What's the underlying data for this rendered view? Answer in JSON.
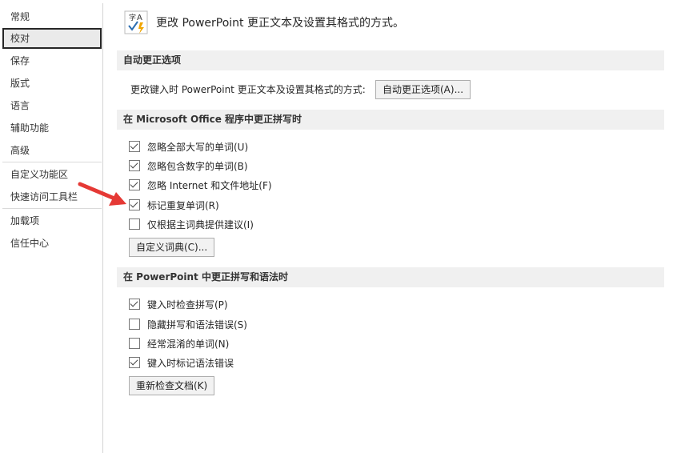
{
  "sidebar": {
    "items": [
      {
        "label": "常规",
        "selected": false
      },
      {
        "label": "校对",
        "selected": true
      },
      {
        "label": "保存",
        "selected": false
      },
      {
        "label": "版式",
        "selected": false
      },
      {
        "label": "语言",
        "selected": false
      },
      {
        "label": "辅助功能",
        "selected": false
      },
      {
        "label": "高级",
        "selected": false
      },
      {
        "label": "自定义功能区",
        "selected": false
      },
      {
        "label": "快速访问工具栏",
        "selected": false
      },
      {
        "label": "加载项",
        "selected": false
      },
      {
        "label": "信任中心",
        "selected": false
      }
    ]
  },
  "header": {
    "title": "更改 PowerPoint 更正文本及设置其格式的方式。",
    "icon": "abc-autocorrect-icon"
  },
  "autocorrect": {
    "section_title": "自动更正选项",
    "description": "更改键入时 PowerPoint 更正文本及设置其格式的方式:",
    "button_label": "自动更正选项(A)..."
  },
  "office_spelling": {
    "section_title": "在 Microsoft Office 程序中更正拼写时",
    "options": [
      {
        "label": "忽略全部大写的单词(U)",
        "checked": true
      },
      {
        "label": "忽略包含数字的单词(B)",
        "checked": true
      },
      {
        "label": "忽略 Internet 和文件地址(F)",
        "checked": true
      },
      {
        "label": "标记重复单词(R)",
        "checked": true
      },
      {
        "label": "仅根据主词典提供建议(I)",
        "checked": false
      }
    ],
    "custom_dict_button": "自定义词典(C)..."
  },
  "ppt_spelling": {
    "section_title": "在 PowerPoint 中更正拼写和语法时",
    "options": [
      {
        "label": "键入时检查拼写(P)",
        "checked": true
      },
      {
        "label": "隐藏拼写和语法错误(S)",
        "checked": false
      },
      {
        "label": "经常混淆的单词(N)",
        "checked": false
      },
      {
        "label": "键入时标记语法错误",
        "checked": true
      }
    ],
    "recheck_button": "重新检查文档(K)"
  },
  "annotation": {
    "arrow_color": "#e53935",
    "icon": "red-arrow-icon"
  }
}
